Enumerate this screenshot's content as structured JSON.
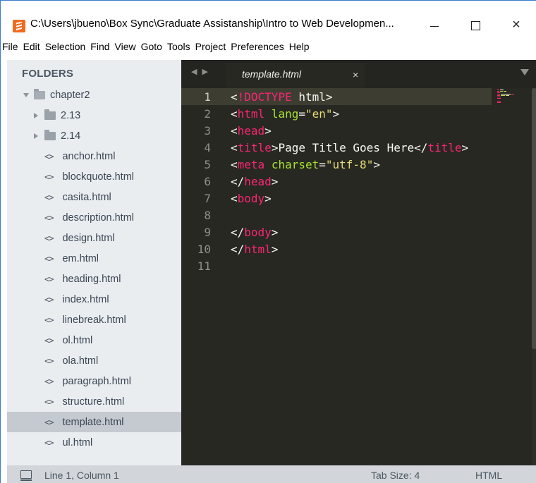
{
  "window": {
    "title": "C:\\Users\\jbueno\\Box Sync\\Graduate Assistanship\\Intro to Web Developmen...",
    "app_icon": "sublime-text-icon",
    "controls": {
      "minimize": "minimize-icon",
      "maximize": "maximize-icon",
      "close": "×"
    }
  },
  "menu": [
    "File",
    "Edit",
    "Selection",
    "Find",
    "View",
    "Goto",
    "Tools",
    "Project",
    "Preferences",
    "Help"
  ],
  "sidebar": {
    "title": "FOLDERS",
    "items": [
      {
        "label": "chapter2",
        "kind": "folder-open"
      },
      {
        "label": "2.13",
        "kind": "folder"
      },
      {
        "label": "2.14",
        "kind": "folder"
      },
      {
        "label": "anchor.html",
        "kind": "file"
      },
      {
        "label": "blockquote.html",
        "kind": "file"
      },
      {
        "label": "casita.html",
        "kind": "file"
      },
      {
        "label": "description.html",
        "kind": "file"
      },
      {
        "label": "design.html",
        "kind": "file"
      },
      {
        "label": "em.html",
        "kind": "file"
      },
      {
        "label": "heading.html",
        "kind": "file"
      },
      {
        "label": "index.html",
        "kind": "file"
      },
      {
        "label": "linebreak.html",
        "kind": "file"
      },
      {
        "label": "ol.html",
        "kind": "file"
      },
      {
        "label": "ola.html",
        "kind": "file"
      },
      {
        "label": "paragraph.html",
        "kind": "file"
      },
      {
        "label": "structure.html",
        "kind": "file"
      },
      {
        "label": "template.html",
        "kind": "file",
        "selected": true
      },
      {
        "label": "ul.html",
        "kind": "file"
      }
    ],
    "file_glyph": "<>"
  },
  "tabs": {
    "nav": "◀ ▶",
    "active_tab": {
      "label": "template.html",
      "close": "×"
    }
  },
  "editor": {
    "active_line": 1,
    "lines": [
      {
        "n": "1",
        "tokens": [
          [
            "punct",
            "<"
          ],
          [
            "tag",
            "!DOCTYPE"
          ],
          [
            "punct",
            " html>"
          ]
        ]
      },
      {
        "n": "2",
        "tokens": [
          [
            "punct",
            "<"
          ],
          [
            "tag",
            "html"
          ],
          [
            "punct",
            " "
          ],
          [
            "attr",
            "lang"
          ],
          [
            "punct",
            "="
          ],
          [
            "str",
            "\"en\""
          ],
          [
            "punct",
            ">"
          ]
        ]
      },
      {
        "n": "3",
        "tokens": [
          [
            "punct",
            "<"
          ],
          [
            "tag",
            "head"
          ],
          [
            "punct",
            ">"
          ]
        ]
      },
      {
        "n": "4",
        "tokens": [
          [
            "punct",
            "<"
          ],
          [
            "tag",
            "title"
          ],
          [
            "punct",
            ">Page Title Goes Here</"
          ],
          [
            "tag",
            "title"
          ],
          [
            "punct",
            ">"
          ]
        ]
      },
      {
        "n": "5",
        "tokens": [
          [
            "punct",
            "<"
          ],
          [
            "tag",
            "meta"
          ],
          [
            "punct",
            " "
          ],
          [
            "attr",
            "charset"
          ],
          [
            "punct",
            "="
          ],
          [
            "str",
            "\"utf-8\""
          ],
          [
            "punct",
            ">"
          ]
        ]
      },
      {
        "n": "6",
        "tokens": [
          [
            "punct",
            "</"
          ],
          [
            "tag",
            "head"
          ],
          [
            "punct",
            ">"
          ]
        ]
      },
      {
        "n": "7",
        "tokens": [
          [
            "punct",
            "<"
          ],
          [
            "tag",
            "body"
          ],
          [
            "punct",
            ">"
          ]
        ]
      },
      {
        "n": "8",
        "tokens": []
      },
      {
        "n": "9",
        "tokens": [
          [
            "punct",
            "</"
          ],
          [
            "tag",
            "body"
          ],
          [
            "punct",
            ">"
          ]
        ]
      },
      {
        "n": "10",
        "tokens": [
          [
            "punct",
            "</"
          ],
          [
            "tag",
            "html"
          ],
          [
            "punct",
            ">"
          ]
        ]
      },
      {
        "n": "11",
        "tokens": []
      }
    ]
  },
  "status": {
    "position": "Line 1, Column 1",
    "tab_size": "Tab Size: 4",
    "syntax": "HTML"
  },
  "colors": {
    "editor_bg": "#272822",
    "sidebar_bg": "#eaedf0",
    "tag": "#f92672",
    "attr": "#a6e22e",
    "string": "#e6db74"
  }
}
